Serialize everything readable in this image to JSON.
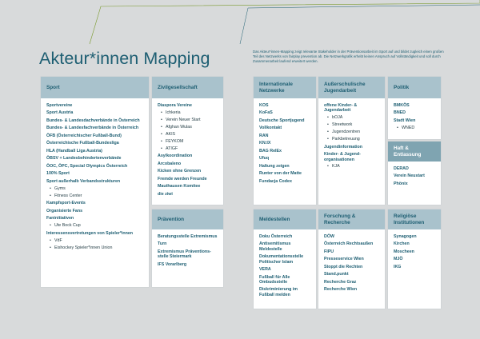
{
  "page": {
    "title": "Akteur*innen Mapping",
    "intro": "Das Akteur*innen-Mapping zeigt relevante Stakeholder in der Präventionsarbeit im Sport auf und bildet zugleich einen großen Teil des Netzwerks von fairplay prevention ab. Die Netzwerkgrafik erhebt keinen Anspruch auf Vollständigkeit und soll durch Zusammenarbeit laufend erweitert werden."
  },
  "colors": {
    "background": "#d8dadb",
    "header": "#a9c2cc",
    "header_dark": "#7fa4b1",
    "text": "#1d5e72",
    "accent_line": "#7a9a2e"
  },
  "cards": {
    "sport": {
      "title": "Sport",
      "items": [
        {
          "text": "Sportvereine"
        },
        {
          "text": "Sport Austria"
        },
        {
          "text": "Bundes- & Landesdachverbände in Österreich"
        },
        {
          "text": "Bundes- & Landesfachverbände in Österreich"
        },
        {
          "text": "ÖFB (Österreichischer Fußball-Bund)"
        },
        {
          "text": "Österreichische Fußball-Bundesliga"
        },
        {
          "text": "HLA (Handball Liga Austria)"
        },
        {
          "text": "ÖBSV + Landesbehindertenverbände"
        },
        {
          "text": "ÖOC, ÖPC, Special Olympics Österreich"
        },
        {
          "text": "100% Sport"
        },
        {
          "text": "Sport außerhalb Verbandsstrukturen"
        },
        {
          "text": "Gyms",
          "sub": true
        },
        {
          "text": "Fitness Center",
          "sub": true
        },
        {
          "text": "Kampfsport-Events"
        },
        {
          "text": "Organisierte Fans"
        },
        {
          "text": "Faninitiativen"
        },
        {
          "text": "Ute Bock Cup",
          "sub": true
        },
        {
          "text": "Interessensvertretungen von Spieler*innen"
        },
        {
          "text": "VdF",
          "sub": true
        },
        {
          "text": "Eishockey Spieler*innen Union",
          "sub": true
        }
      ]
    },
    "zivil": {
      "title": "Zivilgesellschaft",
      "items": [
        {
          "text": "Diaspora Vereine"
        },
        {
          "text": "Ichkeria",
          "sub": true
        },
        {
          "text": "Verein Neuer Start",
          "sub": true
        },
        {
          "text": "Afghan Wulas",
          "sub": true
        },
        {
          "text": "AKIS",
          "sub": true
        },
        {
          "text": "FEYKOM",
          "sub": true
        },
        {
          "text": "ATIGF",
          "sub": true
        },
        {
          "text": "Asylkoordination"
        },
        {
          "text": "Arcobaleno"
        },
        {
          "text": "Kicken ohne Grenzen"
        },
        {
          "text": "Fremde werden Freunde"
        },
        {
          "text": "Mauthausen Komitee"
        },
        {
          "text": "die ziwi"
        }
      ]
    },
    "praevention": {
      "title": "Prävention",
      "items": [
        {
          "text": "Beratungsstelle Extremismus"
        },
        {
          "text": "Turn"
        },
        {
          "text": "Extremismus Präventions-stelle Steiermark"
        },
        {
          "text": "IFS Vorarlberg"
        }
      ]
    },
    "internationale": {
      "title": "Internationale Netzwerke",
      "items": [
        {
          "text": "KOS"
        },
        {
          "text": "KoFaS"
        },
        {
          "text": "Deutsche Sportjugend"
        },
        {
          "text": "Vollkontakt"
        },
        {
          "text": "RAN"
        },
        {
          "text": "KN:IX"
        },
        {
          "text": "BAG RelEx"
        },
        {
          "text": "Ufuq"
        },
        {
          "text": "Haltung zeigen"
        },
        {
          "text": "Runter von der Matte"
        },
        {
          "text": "Fundacja Codex"
        }
      ]
    },
    "jugend": {
      "title": "Außerschulische Jugendarbeit",
      "items": [
        {
          "text": "offene Kinder- & Jugendarbeit"
        },
        {
          "text": "bOJA",
          "sub": true
        },
        {
          "text": "Streetwork",
          "sub": true
        },
        {
          "text": "Jugendzentren",
          "sub": true
        },
        {
          "text": "Parkbetreuung",
          "sub": true
        },
        {
          "text": "Jugendinformation"
        },
        {
          "text": "Kinder- & Jugend-organisationen"
        },
        {
          "text": "KJA",
          "sub": true
        }
      ]
    },
    "politik": {
      "title": "Politik",
      "items": [
        {
          "text": "BMKÖS"
        },
        {
          "text": "BNED"
        },
        {
          "text": "Stadt Wien"
        },
        {
          "text": "WNED",
          "sub": true
        }
      ]
    },
    "haft": {
      "title": "Haft & Entlassung",
      "items": [
        {
          "text": "DERAD"
        },
        {
          "text": "Verein Neustart"
        },
        {
          "text": "Phönix"
        }
      ]
    },
    "meldestellen": {
      "title": "Meldestellen",
      "items": [
        {
          "text": "Doku Österreich"
        },
        {
          "text": "Antisemitismus Meldestelle"
        },
        {
          "text": "Dokumentationsstelle Politischer Islam"
        },
        {
          "text": "VERA"
        },
        {
          "text": "Fußball für Alle Ombudsstelle"
        },
        {
          "text": "Diskriminierung im Fußball melden"
        }
      ]
    },
    "forschung": {
      "title": "Forschung & Recherche",
      "items": [
        {
          "text": "DÖW"
        },
        {
          "text": "Österreich Rechtsaußen"
        },
        {
          "text": "FIPU"
        },
        {
          "text": "Presseservice Wien"
        },
        {
          "text": "Stoppt die Rechten"
        },
        {
          "text": "Stand.punkt"
        },
        {
          "text": "Recherche Graz"
        },
        {
          "text": "Recherche Wien"
        }
      ]
    },
    "religion": {
      "title": "Religiöse Institutionen",
      "items": [
        {
          "text": "Synagogen"
        },
        {
          "text": "Kirchen"
        },
        {
          "text": "Moscheen"
        },
        {
          "text": "MJÖ"
        },
        {
          "text": "IKG"
        }
      ]
    }
  }
}
